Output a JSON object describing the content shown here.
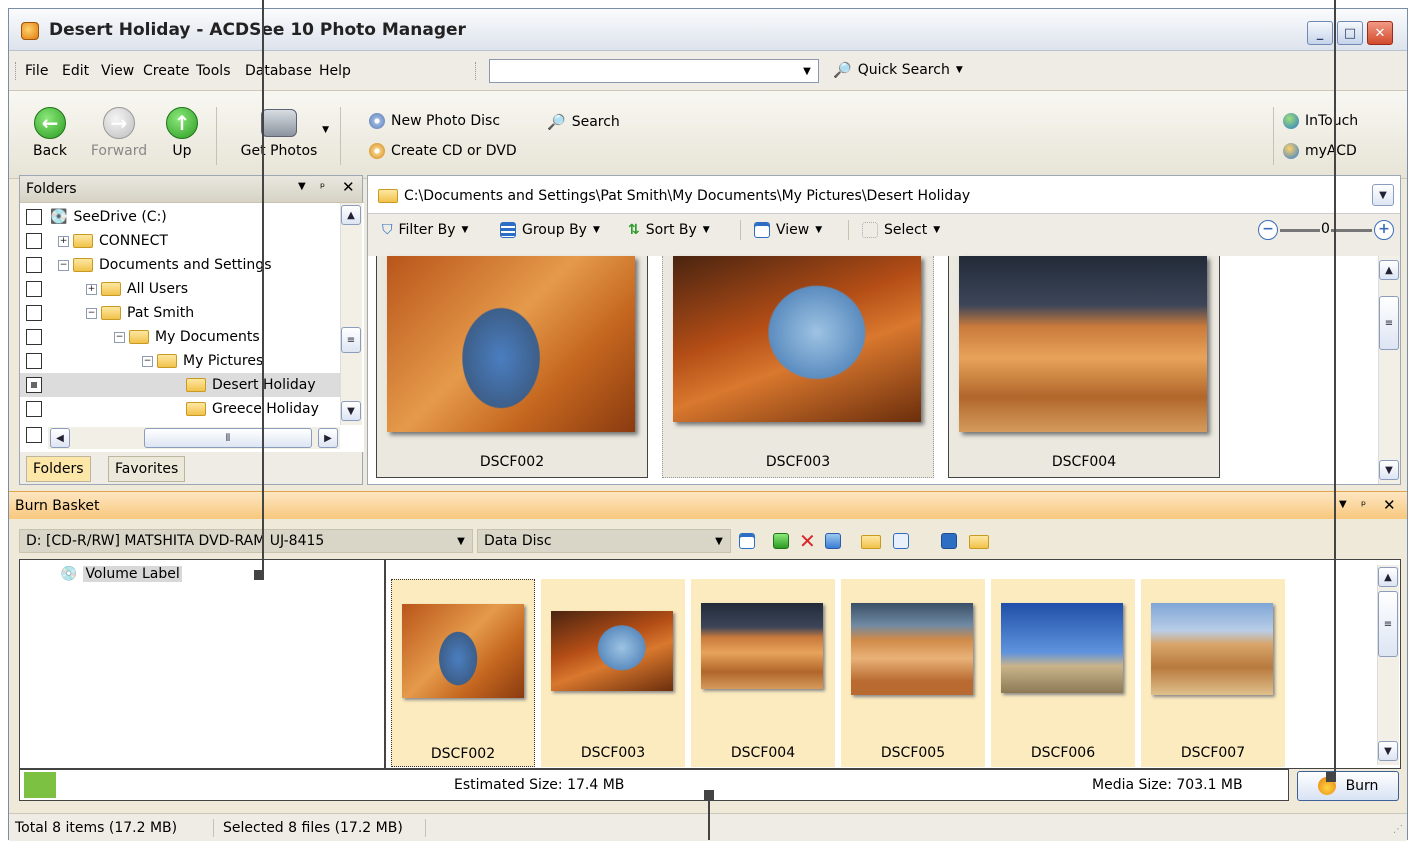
{
  "window": {
    "title": "Desert Holiday - ACDSee 10 Photo Manager"
  },
  "menu": {
    "items": [
      "File",
      "Edit",
      "View",
      "Create",
      "Tools",
      "Database",
      "Help"
    ],
    "search_value": "",
    "quick_search": "Quick Search"
  },
  "toolbar": {
    "back": "Back",
    "forward": "Forward",
    "up": "Up",
    "get_photos": "Get Photos",
    "new_photo_disc": "New Photo Disc",
    "search": "Search",
    "create_cd": "Create CD or DVD",
    "intouch": "InTouch",
    "myacd": "myACD"
  },
  "folders": {
    "title": "Folders",
    "tree": [
      "SeeDrive (C:)",
      "CONNECT",
      "Documents and Settings",
      "All Users",
      "Pat Smith",
      "My Documents",
      "My Pictures",
      "Desert Holiday",
      "Greece Holiday"
    ],
    "tabs": [
      "Folders",
      "Favorites"
    ]
  },
  "browser": {
    "path": "C:\\Documents and Settings\\Pat Smith\\My Documents\\My Pictures\\Desert Holiday",
    "filter_by": "Filter By",
    "group_by": "Group By",
    "sort_by": "Sort By",
    "view": "View",
    "select": "Select",
    "zoom_value": "0",
    "thumbs": [
      "DSCF002",
      "DSCF003",
      "DSCF004"
    ]
  },
  "burn": {
    "title": "Burn Basket",
    "drive": "D: [CD-R/RW] MATSHITA DVD-RAM UJ-8415",
    "disc_type": "Data Disc",
    "volume_label": "Volume Label",
    "items": [
      "DSCF002",
      "DSCF003",
      "DSCF004",
      "DSCF005",
      "DSCF006",
      "DSCF007"
    ],
    "estimated": "Estimated Size: 17.4 MB",
    "media": "Media Size: 703.1 MB",
    "burn_button": "Burn",
    "progress": 0.025
  },
  "status": {
    "total": "Total 8 items  (17.2 MB)",
    "selected": "Selected 8 files (17.2 MB)"
  },
  "colors": {
    "accent": "#f8c87d",
    "selection": "#fcebbf"
  }
}
